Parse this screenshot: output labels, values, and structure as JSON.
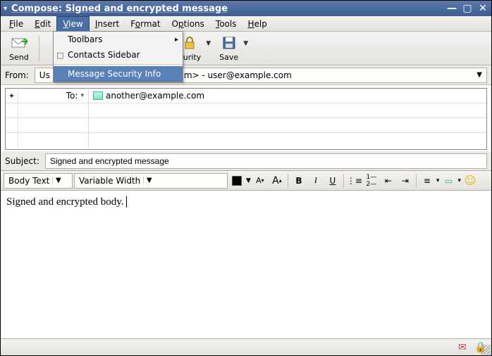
{
  "window": {
    "title": "Compose: Signed and encrypted message"
  },
  "menu": {
    "file": "File",
    "edit": "Edit",
    "view": "View",
    "insert": "Insert",
    "format": "Format",
    "options": "Options",
    "tools": "Tools",
    "help": "Help"
  },
  "view_menu": {
    "toolbars": "Toolbars",
    "contacts_sidebar": "Contacts Sidebar",
    "msg_sec_info": "Message Security Info"
  },
  "toolbar": {
    "send": "Send",
    "security": "curity",
    "save": "Save"
  },
  "from": {
    "label": "From:",
    "value_left": "Us",
    "value_right": "m>   - user@example.com"
  },
  "recipients": {
    "to_label": "To:",
    "to_value": "another@example.com"
  },
  "subject": {
    "label": "Subject:",
    "value": "Signed and encrypted message"
  },
  "format_bar": {
    "para": "Body Text",
    "font": "Variable Width",
    "smallA": "A",
    "bigA": "A",
    "bold": "B",
    "italic": "I",
    "underline": "U"
  },
  "body_text": "Signed and encrypted body.",
  "icons": {
    "send": "✉",
    "lock": "🔒",
    "save": "💾",
    "smile": "☺",
    "seal": "✉",
    "padlock": "🔒"
  }
}
